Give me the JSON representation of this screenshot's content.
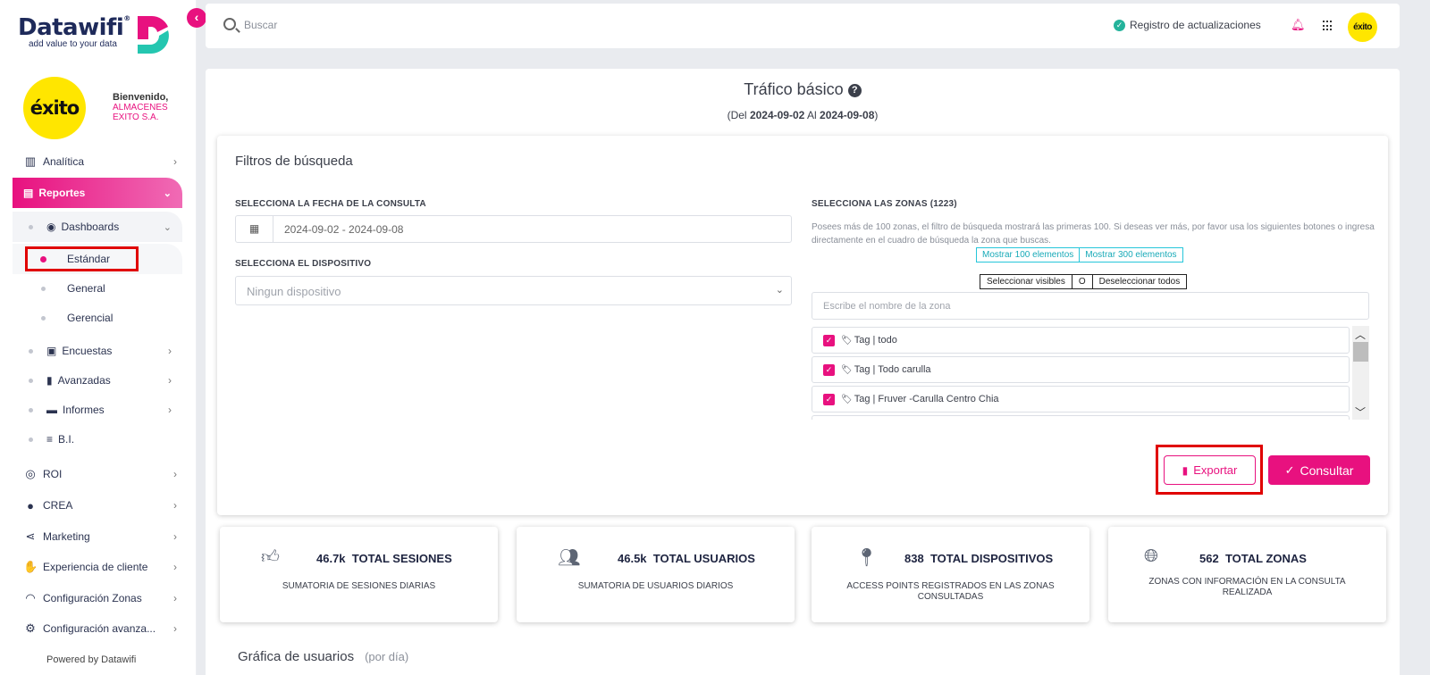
{
  "brand": {
    "name": "Datawifi",
    "tagline": "add value to your data",
    "client_logo": "éxito"
  },
  "welcome": {
    "greeting": "Bienvenido,",
    "company_line1": "ALMACENES",
    "company_line2": "EXITO S.A."
  },
  "sidebar": {
    "items": [
      {
        "label": "Analítica",
        "icon": "chart-bar-icon"
      },
      {
        "label": "Reportes",
        "icon": "document-icon"
      },
      {
        "label": "ROI",
        "icon": "coins-icon"
      },
      {
        "label": "CREA",
        "icon": "lightbulb-icon"
      },
      {
        "label": "Marketing",
        "icon": "share-icon"
      },
      {
        "label": "Experiencia de cliente",
        "icon": "thumbs-up-icon"
      },
      {
        "label": "Configuración Zonas",
        "icon": "wifi-icon"
      },
      {
        "label": "Configuración avanza...",
        "icon": "gear-icon"
      }
    ],
    "reportes_sub": [
      {
        "label": "Dashboards"
      },
      {
        "label": "Estándar"
      },
      {
        "label": "General"
      },
      {
        "label": "Gerencial"
      },
      {
        "label": "Encuestas"
      },
      {
        "label": "Avanzadas"
      },
      {
        "label": "Informes"
      },
      {
        "label": "B.I."
      }
    ],
    "powered": "Powered by Datawifi"
  },
  "topbar": {
    "search_placeholder": "Buscar",
    "changelog": "Registro de actualizaciones",
    "avatar_text": "éxito"
  },
  "page": {
    "title": "Tráfico básico",
    "range_prefix": "(Del",
    "range_from": "2024-09-02",
    "range_mid": "Al",
    "range_to": "2024-09-08",
    "range_suffix": ")"
  },
  "filters": {
    "title": "Filtros de búsqueda",
    "date_label": "SELECCIONA LA FECHA DE LA CONSULTA",
    "date_value": "2024-09-02 - 2024-09-08",
    "device_label": "SELECCIONA EL DISPOSITIVO",
    "device_value": "Ningun dispositivo",
    "zones_label": "SELECCIONA LAS ZONAS (1223)",
    "zones_note": "Posees más de 100 zonas, el filtro de búsqueda mostrará las primeras 100. Si deseas ver más, por favor usa los siguientes botones o ingresa directamente en el cuadro de búsqueda la zona que buscas.",
    "show_100": "Mostrar 100 elementos",
    "show_300": "Mostrar 300 elementos",
    "select_visible": "Seleccionar visibles",
    "sep": "O",
    "deselect_all": "Deseleccionar todos",
    "zone_search_placeholder": "Escribe el nombre de la zona",
    "zones": [
      {
        "label": "Tag | todo",
        "checked": true
      },
      {
        "label": "Tag | Todo carulla",
        "checked": true
      },
      {
        "label": "Tag | Fruver -Carulla Centro Chia",
        "checked": true
      }
    ],
    "export_label": "Exportar",
    "consult_label": "Consultar"
  },
  "stats": [
    {
      "value": "46.7k",
      "label": "TOTAL SESIONES",
      "sub1": "SUMATORIA DE SESIONES DIARIAS",
      "sub2": "",
      "icon": "thumbs-up-icon"
    },
    {
      "value": "46.5k",
      "label": "TOTAL USUARIOS",
      "sub1": "SUMATORIA DE USUARIOS DIARIOS",
      "sub2": "",
      "icon": "users-icon"
    },
    {
      "value": "838",
      "label": "TOTAL DISPOSITIVOS",
      "sub1": "ACCESS POINTS REGISTRADOS EN LAS ZONAS",
      "sub2": "CONSULTADAS",
      "icon": "map-pin-icon"
    },
    {
      "value": "562",
      "label": "TOTAL ZONAS",
      "sub1": "ZONAS CON INFORMACIÓN EN LA CONSULTA",
      "sub2": "REALIZADA",
      "icon": "globe-icon"
    }
  ],
  "chart_section": {
    "title": "Gráfica de usuarios",
    "period": "(por día)"
  },
  "colors": {
    "accent": "#e8117f",
    "brand_teal": "#24c6b0",
    "brand_navy": "#1e2a5a",
    "client_yellow": "#ffe600",
    "highlight_red": "#e00000"
  }
}
